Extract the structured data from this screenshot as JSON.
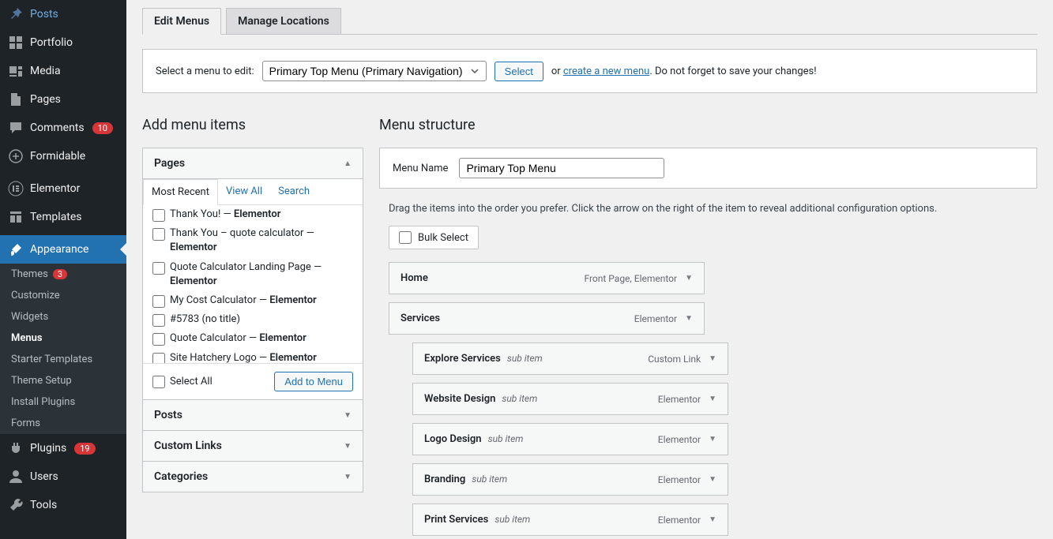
{
  "sidebar": {
    "items": [
      {
        "label": "Posts",
        "icon": "pin"
      },
      {
        "label": "Portfolio",
        "icon": "grid"
      },
      {
        "label": "Media",
        "icon": "media"
      },
      {
        "label": "Pages",
        "icon": "page"
      },
      {
        "label": "Comments",
        "icon": "comment",
        "badge": "10"
      },
      {
        "label": "Formidable",
        "icon": "form"
      }
    ],
    "items2": [
      {
        "label": "Elementor",
        "icon": "elementor"
      },
      {
        "label": "Templates",
        "icon": "templates"
      }
    ],
    "appearance": {
      "label": "Appearance",
      "icon": "brush"
    },
    "submenu": [
      {
        "label": "Themes",
        "badge": "3"
      },
      {
        "label": "Customize"
      },
      {
        "label": "Widgets"
      },
      {
        "label": "Menus",
        "current": true
      },
      {
        "label": "Starter Templates"
      },
      {
        "label": "Theme Setup"
      },
      {
        "label": "Install Plugins"
      },
      {
        "label": "Forms"
      }
    ],
    "items3": [
      {
        "label": "Plugins",
        "icon": "plugin",
        "badge": "19"
      },
      {
        "label": "Users",
        "icon": "user"
      },
      {
        "label": "Tools",
        "icon": "wrench"
      }
    ]
  },
  "tabs": {
    "edit": "Edit Menus",
    "locations": "Manage Locations"
  },
  "select_row": {
    "label": "Select a menu to edit:",
    "option": "Primary Top Menu (Primary Navigation)",
    "select_btn": "Select",
    "or": "or",
    "create_link": "create a new menu",
    "after": ". Do not forget to save your changes!"
  },
  "headings": {
    "add": "Add menu items",
    "structure": "Menu structure"
  },
  "accordion": {
    "pages": "Pages",
    "posts": "Posts",
    "custom": "Custom Links",
    "categories": "Categories",
    "subtabs": {
      "recent": "Most Recent",
      "all": "View All",
      "search": "Search"
    },
    "page_items": [
      {
        "pre": "Thank You! — ",
        "strong": "Elementor"
      },
      {
        "pre": "Thank You – quote calculator — ",
        "strong": "Elementor",
        "wrap": true
      },
      {
        "pre": "Quote Calculator Landing Page — ",
        "strong": "Elementor",
        "wrap": true
      },
      {
        "pre": "My Cost Calculator — ",
        "strong": "Elementor"
      },
      {
        "pre": "#5783 (no title)",
        "strong": ""
      },
      {
        "pre": "Quote Calculator — ",
        "strong": "Elementor"
      },
      {
        "pre": "Site Hatchery Logo — ",
        "strong": "Elementor"
      }
    ],
    "select_all": "Select All",
    "add_to_menu": "Add to Menu"
  },
  "menu_name": {
    "label": "Menu Name",
    "value": "Primary Top Menu"
  },
  "instructions": "Drag the items into the order you prefer. Click the arrow on the right of the item to reveal additional configuration options.",
  "bulk_select": "Bulk Select",
  "menu_items": [
    {
      "title": "Home",
      "type": "Front Page, Elementor",
      "sub": false
    },
    {
      "title": "Services",
      "type": "Elementor",
      "sub": false
    },
    {
      "title": "Explore Services",
      "subtext": "sub item",
      "type": "Custom Link",
      "sub": true
    },
    {
      "title": "Website Design",
      "subtext": "sub item",
      "type": "Elementor",
      "sub": true
    },
    {
      "title": "Logo Design",
      "subtext": "sub item",
      "type": "Elementor",
      "sub": true
    },
    {
      "title": "Branding",
      "subtext": "sub item",
      "type": "Elementor",
      "sub": true
    },
    {
      "title": "Print Services",
      "subtext": "sub item",
      "type": "Elementor",
      "sub": true
    }
  ]
}
